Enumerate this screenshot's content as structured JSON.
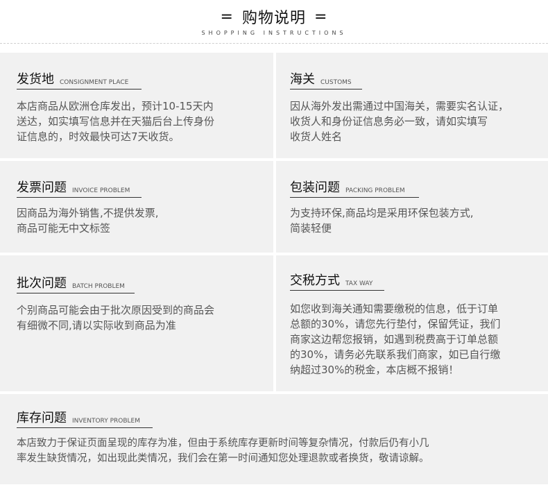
{
  "header": {
    "eq_left": "=",
    "title": "购物说明",
    "eq_right": "=",
    "subtitle": "SHOPPING INSTRUCTIONS"
  },
  "panels": {
    "shipping": {
      "title_cn": "发货地",
      "title_en": "CONSIGNMENT PLACE",
      "lines": [
        "本店商品从欧洲仓库发出，预计10-15天内",
        "送达，如实填写信息并在天猫后台上传身份",
        "证信息的，时效最快可达7天收货。"
      ]
    },
    "customs": {
      "title_cn": "海关",
      "title_en": "CUSTOMS",
      "lines": [
        "因从海外发出需通过中国海关，需要实名认证，",
        "收货人和身份证信息务必一致，请如实填写",
        "收货人姓名"
      ]
    },
    "invoice": {
      "title_cn": "发票问题",
      "title_en": "INVOICE PROBLEM",
      "lines": [
        "因商品为海外销售,不提供发票,",
        "商品可能无中文标签"
      ]
    },
    "packing": {
      "title_cn": "包装问题",
      "title_en": "PACKING PROBLEM",
      "lines": [
        "为支持环保,商品均是采用环保包装方式,",
        "简装轻便"
      ]
    },
    "batch": {
      "title_cn": "批次问题",
      "title_en": "BATCH PROBLEM",
      "lines": [
        "个别商品可能会由于批次原因受到的商品会",
        "有细微不同,请以实际收到商品为准"
      ]
    },
    "tax": {
      "title_cn": "交税方式",
      "title_en": "TAX WAY",
      "lines": [
        "如您收到海关通知需要缴税的信息，低于订单",
        "总额的30%，请您先行垫付，保留凭证，我们",
        "商家这边帮您报销，如遇到税费高于订单总额",
        "的30%，请务必先联系我们商家，如已自行缴",
        "纳超过30%的税金，本店概不报销！"
      ]
    },
    "inventory": {
      "title_cn": "库存问题",
      "title_en": "INVENTORY PROBLEM",
      "lines": [
        "本店致力于保证页面呈现的库存为准，但由于系统库存更新时间等复杂情况，付款后仍有小几",
        "率发生缺货情况，如出现此类情况，我们会在第一时间通知您处理退款或者换货，敬请谅解。"
      ]
    }
  }
}
